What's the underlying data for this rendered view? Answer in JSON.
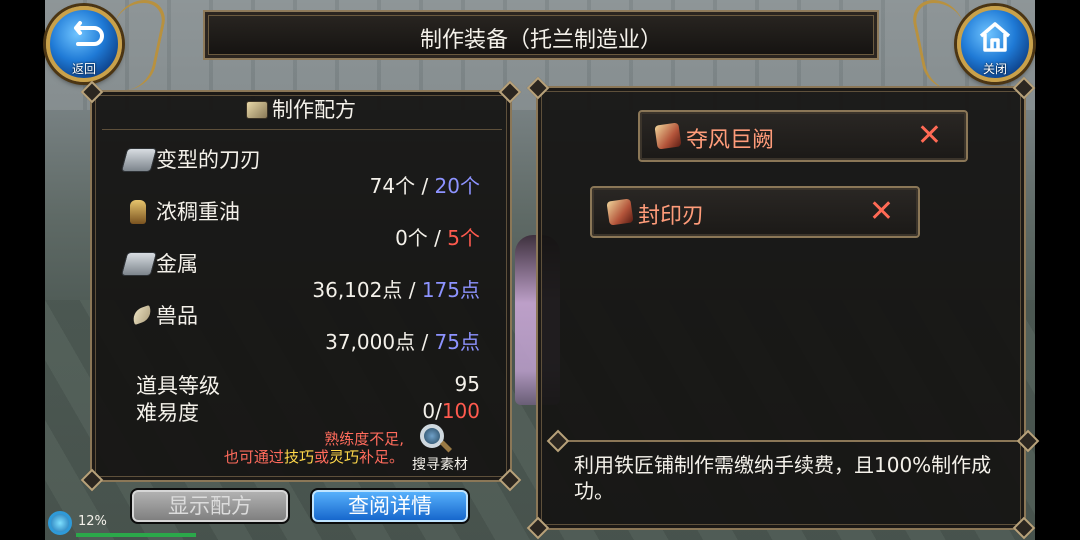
{
  "nav": {
    "back_label": "返回",
    "close_label": "关闭"
  },
  "title": "制作装备（托兰制造业）",
  "recipe": {
    "header": "制作配方",
    "materials": [
      {
        "name": "变型的刀刃",
        "have": "74个",
        "sep": " / ",
        "need": "20个",
        "icon": "ingot-icon",
        "need_color": "#8d93ff"
      },
      {
        "name": "浓稠重油",
        "have": "0个",
        "sep": " / ",
        "need": "5个",
        "icon": "oil-bottle-icon",
        "need_color": "#ff5a4e"
      },
      {
        "name": "金属",
        "have": "36,102点",
        "sep": " / ",
        "need": "175点",
        "icon": "metal-ingot-icon",
        "need_color": "#8d93ff"
      },
      {
        "name": "兽品",
        "have": "37,000点",
        "sep": " / ",
        "need": "75点",
        "icon": "fang-icon",
        "need_color": "#8d93ff"
      }
    ],
    "item_level_label": "道具等级",
    "item_level_value": "95",
    "difficulty_label": "难易度",
    "difficulty_have": "0/",
    "difficulty_max": "100",
    "warning_line1": "熟练度不足,",
    "warning_line2_a": "也可通过",
    "warning_line2_b": "技巧",
    "warning_line2_c": "或",
    "warning_line2_d": "灵巧",
    "warning_line2_e": "补足。",
    "search_label": "搜寻素材"
  },
  "buttons": {
    "show_recipe": "显示配方",
    "view_details": "查阅详情"
  },
  "status": {
    "percent": "12%"
  },
  "equipment": [
    {
      "name": "夺风巨阙"
    },
    {
      "name": "封印刃"
    }
  ],
  "description": "利用铁匠铺制作需缴纳手续费，且100%制作成功。",
  "colors": {
    "accent_blue": "#1f7ad6",
    "gold_frame": "#c9a14a",
    "requirement_blue": "#8d93ff",
    "requirement_red": "#ff5a4e",
    "equip_name": "#ff9c7a"
  }
}
